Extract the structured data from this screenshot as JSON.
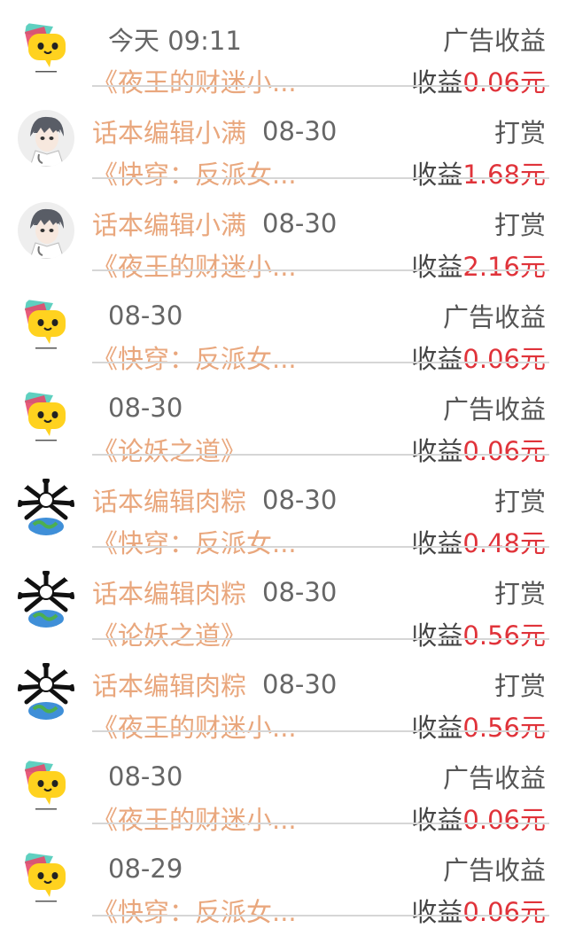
{
  "colors": {
    "accent_orange": "#e9a77d",
    "amount_red": "#e0333a",
    "text_gray": "#666666"
  },
  "rows": [
    {
      "avatar": "emoji-yellow-icon",
      "editor": "",
      "date": "今天 09:11",
      "type": "广告收益",
      "book": "《夜王的财迷小...",
      "earn_label": "收益",
      "amount": "0.06元"
    },
    {
      "avatar": "anime-doctor-icon",
      "editor": "话本编辑小满",
      "date": "08-30",
      "type": "打赏",
      "book": "《快穿：反派女...",
      "earn_label": "收益",
      "amount": "1.68元"
    },
    {
      "avatar": "anime-doctor-icon",
      "editor": "话本编辑小满",
      "date": "08-30",
      "type": "打赏",
      "book": "《夜王的财迷小...",
      "earn_label": "收益",
      "amount": "2.16元"
    },
    {
      "avatar": "emoji-yellow-icon",
      "editor": "",
      "date": "08-30",
      "type": "广告收益",
      "book": "《快穿：反派女...",
      "earn_label": "收益",
      "amount": "0.06元"
    },
    {
      "avatar": "emoji-yellow-icon",
      "editor": "",
      "date": "08-30",
      "type": "广告收益",
      "book": "《论妖之道》",
      "earn_label": "收益",
      "amount": "0.06元"
    },
    {
      "avatar": "bones-globe-icon",
      "editor": "话本编辑肉粽",
      "date": "08-30",
      "type": "打赏",
      "book": "《快穿：反派女...",
      "earn_label": "收益",
      "amount": "0.48元"
    },
    {
      "avatar": "bones-globe-icon",
      "editor": "话本编辑肉粽",
      "date": "08-30",
      "type": "打赏",
      "book": "《论妖之道》",
      "earn_label": "收益",
      "amount": "0.56元"
    },
    {
      "avatar": "bones-globe-icon",
      "editor": "话本编辑肉粽",
      "date": "08-30",
      "type": "打赏",
      "book": "《夜王的财迷小...",
      "earn_label": "收益",
      "amount": "0.56元"
    },
    {
      "avatar": "emoji-yellow-icon",
      "editor": "",
      "date": "08-30",
      "type": "广告收益",
      "book": "《夜王的财迷小...",
      "earn_label": "收益",
      "amount": "0.06元"
    },
    {
      "avatar": "emoji-yellow-icon",
      "editor": "",
      "date": "08-29",
      "type": "广告收益",
      "book": "《快穿：反派女...",
      "earn_label": "收益",
      "amount": "0.06元"
    }
  ]
}
